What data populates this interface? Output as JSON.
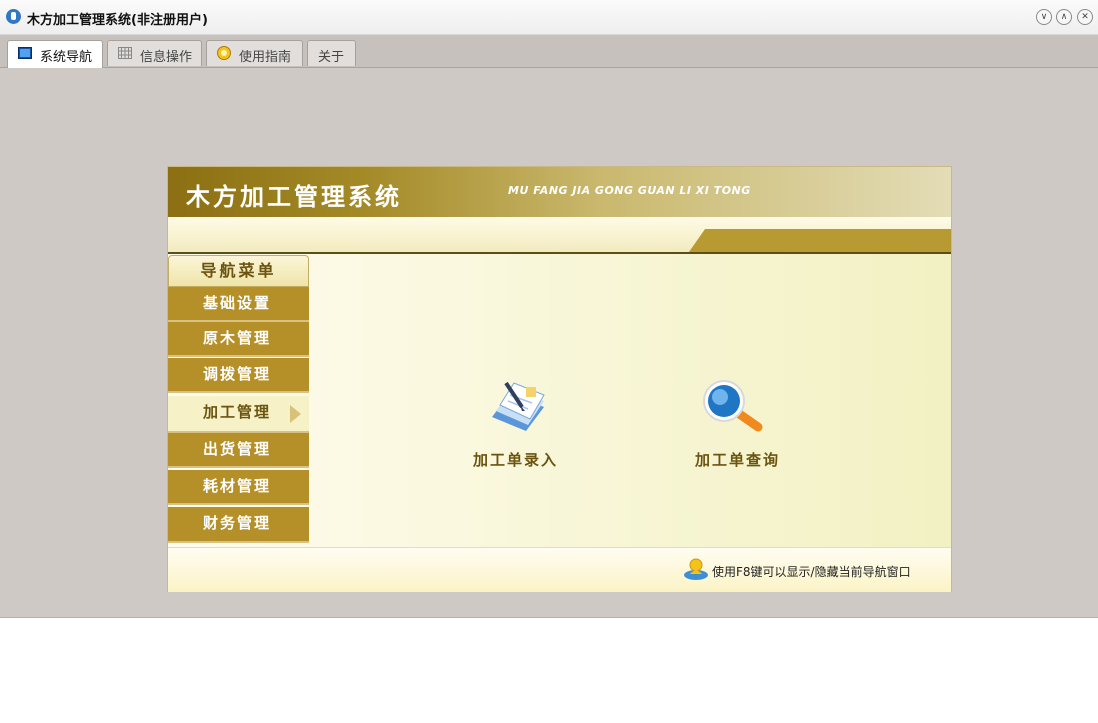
{
  "window": {
    "title": "木方加工管理系统(非注册用户)",
    "controls": [
      "minimize",
      "maximize",
      "close"
    ]
  },
  "tabs": [
    {
      "label": "系统导航",
      "icon": "monitor-icon",
      "active": true
    },
    {
      "label": "信息操作",
      "icon": "grid-icon",
      "active": false
    },
    {
      "label": "使用指南",
      "icon": "guide-icon",
      "active": false
    },
    {
      "label": "关于",
      "icon": "",
      "active": false
    }
  ],
  "banner": {
    "title": "木方加工管理系统",
    "subtitle": "MU FANG JIA GONG GUAN LI XI TONG"
  },
  "nav": {
    "header": "导航菜单",
    "items": [
      {
        "label": "基础设置",
        "active": false
      },
      {
        "label": "原木管理",
        "active": false
      },
      {
        "label": "调拨管理",
        "active": false
      },
      {
        "label": "加工管理",
        "active": true
      },
      {
        "label": "出货管理",
        "active": false
      },
      {
        "label": "耗材管理",
        "active": false
      },
      {
        "label": "财务管理",
        "active": false
      }
    ]
  },
  "functions": [
    {
      "label": "加工单录入",
      "icon": "document-edit-icon"
    },
    {
      "label": "加工单查询",
      "icon": "magnifier-icon"
    }
  ],
  "footer": {
    "tip": "使用F8键可以显示/隐藏当前导航窗口"
  },
  "colors": {
    "accent_gold": "#b58f27",
    "banner_dark": "#8b6f12",
    "text_brown": "#6b5410",
    "frame_gray": "#cfc9c5"
  }
}
